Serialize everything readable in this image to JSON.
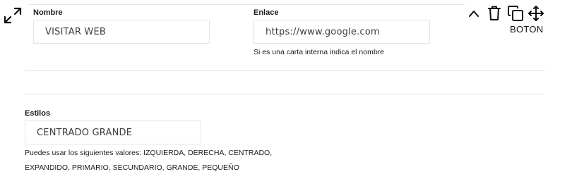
{
  "nombre": {
    "label": "Nombre",
    "value": "VISITAR WEB"
  },
  "enlace": {
    "label": "Enlace",
    "value": "https://www.google.com",
    "help": "Si es una carta interna indica el nombre"
  },
  "estilos": {
    "label": "Estilos",
    "value": "CENTRADO GRANDE",
    "help_line1": "Puedes usar los siguientes valores: IZQUIERDA, DERECHA, CENTRADO,",
    "help_line2": "EXPANDIDO, PRIMARIO, SECUNDARIO, GRANDE, PEQUEÑO"
  },
  "toolbar": {
    "block_type": "BOTON",
    "icons": [
      "chevron-up-icon",
      "trash-icon",
      "duplicate-icon",
      "move-icon"
    ]
  },
  "expand_icon": "expand-arrows-icon"
}
